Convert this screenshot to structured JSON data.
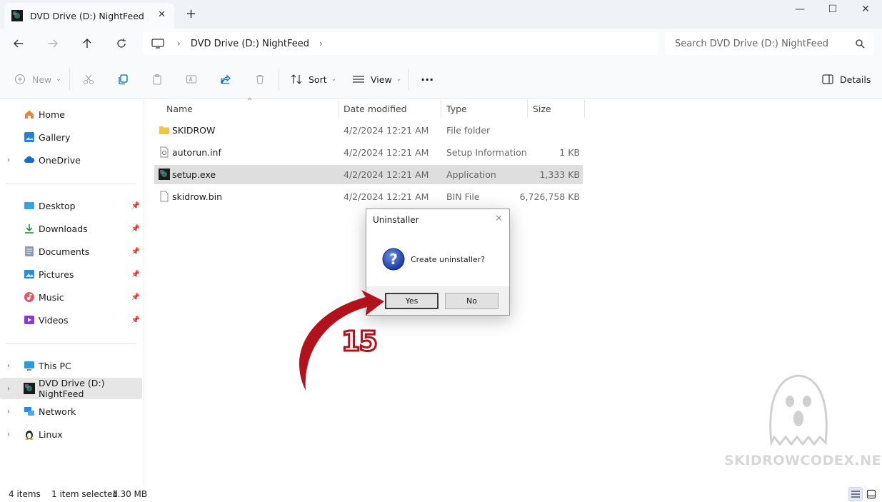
{
  "tab": {
    "title": "DVD Drive (D:) NightFeed",
    "close": "✕",
    "new": "+"
  },
  "window_controls": {
    "minimize": "—",
    "maximize": "☐",
    "close": "✕"
  },
  "address": {
    "crumbs": [
      "DVD Drive (D:) NightFeed"
    ],
    "separator": "›",
    "search_placeholder": "Search DVD Drive (D:) NightFeed"
  },
  "toolbar": {
    "new_label": "New",
    "sort_label": "Sort",
    "view_label": "View",
    "more_label": "···",
    "details_label": "Details"
  },
  "sidebar": {
    "quick": [
      {
        "label": "Home",
        "icon": "home-icon"
      },
      {
        "label": "Gallery",
        "icon": "gallery-icon"
      },
      {
        "label": "OneDrive",
        "icon": "cloud-icon",
        "expandable": true
      }
    ],
    "pinned": [
      {
        "label": "Desktop",
        "icon": "desktop-icon"
      },
      {
        "label": "Downloads",
        "icon": "download-icon"
      },
      {
        "label": "Documents",
        "icon": "documents-icon"
      },
      {
        "label": "Pictures",
        "icon": "pictures-icon"
      },
      {
        "label": "Music",
        "icon": "music-icon"
      },
      {
        "label": "Videos",
        "icon": "videos-icon"
      }
    ],
    "devices": [
      {
        "label": "This PC",
        "icon": "pc-icon"
      },
      {
        "label": "DVD Drive (D:) NightFeed",
        "icon": "dvd-icon",
        "selected": true
      },
      {
        "label": "Network",
        "icon": "network-icon"
      },
      {
        "label": "Linux",
        "icon": "linux-icon"
      }
    ]
  },
  "columns": {
    "name": "Name",
    "date": "Date modified",
    "type": "Type",
    "size": "Size"
  },
  "files": [
    {
      "name": "SKIDROW",
      "date": "4/2/2024 12:21 AM",
      "type": "File folder",
      "size": "",
      "icon": "folder-icon"
    },
    {
      "name": "autorun.inf",
      "date": "4/2/2024 12:21 AM",
      "type": "Setup Information",
      "size": "1 KB",
      "icon": "settings-file-icon"
    },
    {
      "name": "setup.exe",
      "date": "4/2/2024 12:21 AM",
      "type": "Application",
      "size": "1,333 KB",
      "icon": "app-icon",
      "selected": true
    },
    {
      "name": "skidrow.bin",
      "date": "4/2/2024 12:21 AM",
      "type": "BIN File",
      "size": "6,726,758 KB",
      "icon": "file-icon"
    }
  ],
  "dialog": {
    "title": "Uninstaller",
    "close": "✕",
    "message": "Create uninstaller?",
    "yes_label": "Yes",
    "no_label": "No"
  },
  "annotation": {
    "step": "15"
  },
  "watermark": {
    "text": "SKIDROWCODEX.NET"
  },
  "status": {
    "count": "4 items",
    "selection": "1 item selected",
    "size": "1.30 MB"
  },
  "colors": {
    "accent": "#0067c0",
    "arrow": "#b1121c",
    "selection": "#dedede"
  }
}
